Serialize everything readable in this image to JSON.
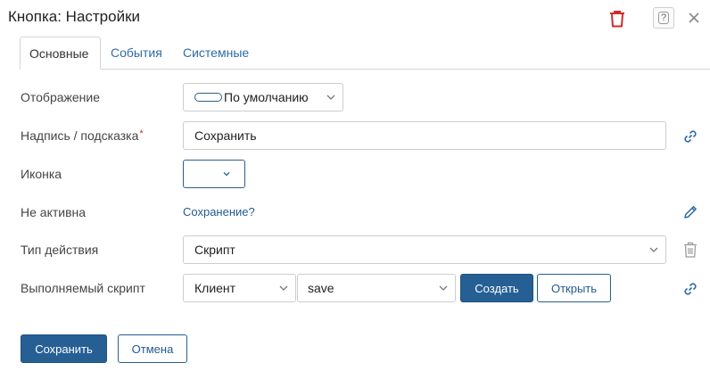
{
  "header": {
    "title": "Кнопка: Настройки",
    "help_glyph": "?",
    "icons": [
      "trash-icon",
      "help-icon",
      "close-icon"
    ]
  },
  "tabs": [
    {
      "label": "Основные",
      "active": true
    },
    {
      "label": "События",
      "active": false
    },
    {
      "label": "Системные",
      "active": false
    }
  ],
  "form": {
    "display": {
      "label": "Отображение",
      "value": "По умолчанию"
    },
    "caption": {
      "label": "Надпись / подсказка",
      "required_mark": "*",
      "value": "Сохранить"
    },
    "icon": {
      "label": "Иконка",
      "value": ""
    },
    "inactive": {
      "label": "Не активна",
      "value": "Сохранение?"
    },
    "action_type": {
      "label": "Тип действия",
      "value": "Скрипт"
    },
    "script": {
      "label": "Выполняемый скрипт",
      "scope_value": "Клиент",
      "script_value": "save",
      "create_label": "Создать",
      "open_label": "Открыть"
    }
  },
  "footer": {
    "save_label": "Сохранить",
    "cancel_label": "Отмена"
  },
  "colors": {
    "accent": "#265f94",
    "link": "#245a8f",
    "delete_red": "#d42a2a",
    "border": "#cdcdcd"
  }
}
